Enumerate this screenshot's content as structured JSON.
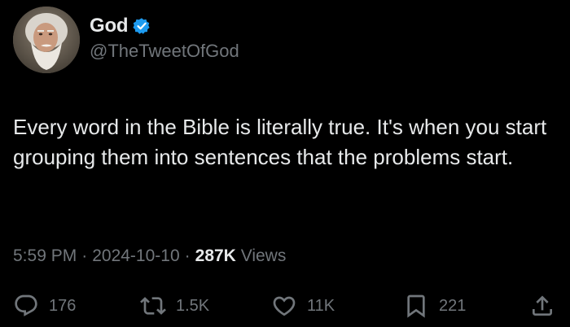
{
  "author": {
    "display_name": "God",
    "handle": "@TheTweetOfGod",
    "verified": true,
    "verified_color": "#1d9bf0"
  },
  "tweet": {
    "text": "Every word in the Bible is literally true.  It's when you start grouping them into sentences that the problems start.",
    "time": "5:59 PM",
    "separator": "·",
    "date": "2024-10-10",
    "views_count": "287K",
    "views_label": "Views"
  },
  "actions": {
    "reply": {
      "icon": "reply-icon",
      "count": "176"
    },
    "retweet": {
      "icon": "retweet-icon",
      "count": "1.5K"
    },
    "like": {
      "icon": "heart-icon",
      "count": "11K"
    },
    "bookmark": {
      "icon": "bookmark-icon",
      "count": "221"
    },
    "share": {
      "icon": "share-icon"
    }
  },
  "colors": {
    "background": "#000000",
    "primary_text": "#e7e9ea",
    "secondary_text": "#71767b"
  }
}
